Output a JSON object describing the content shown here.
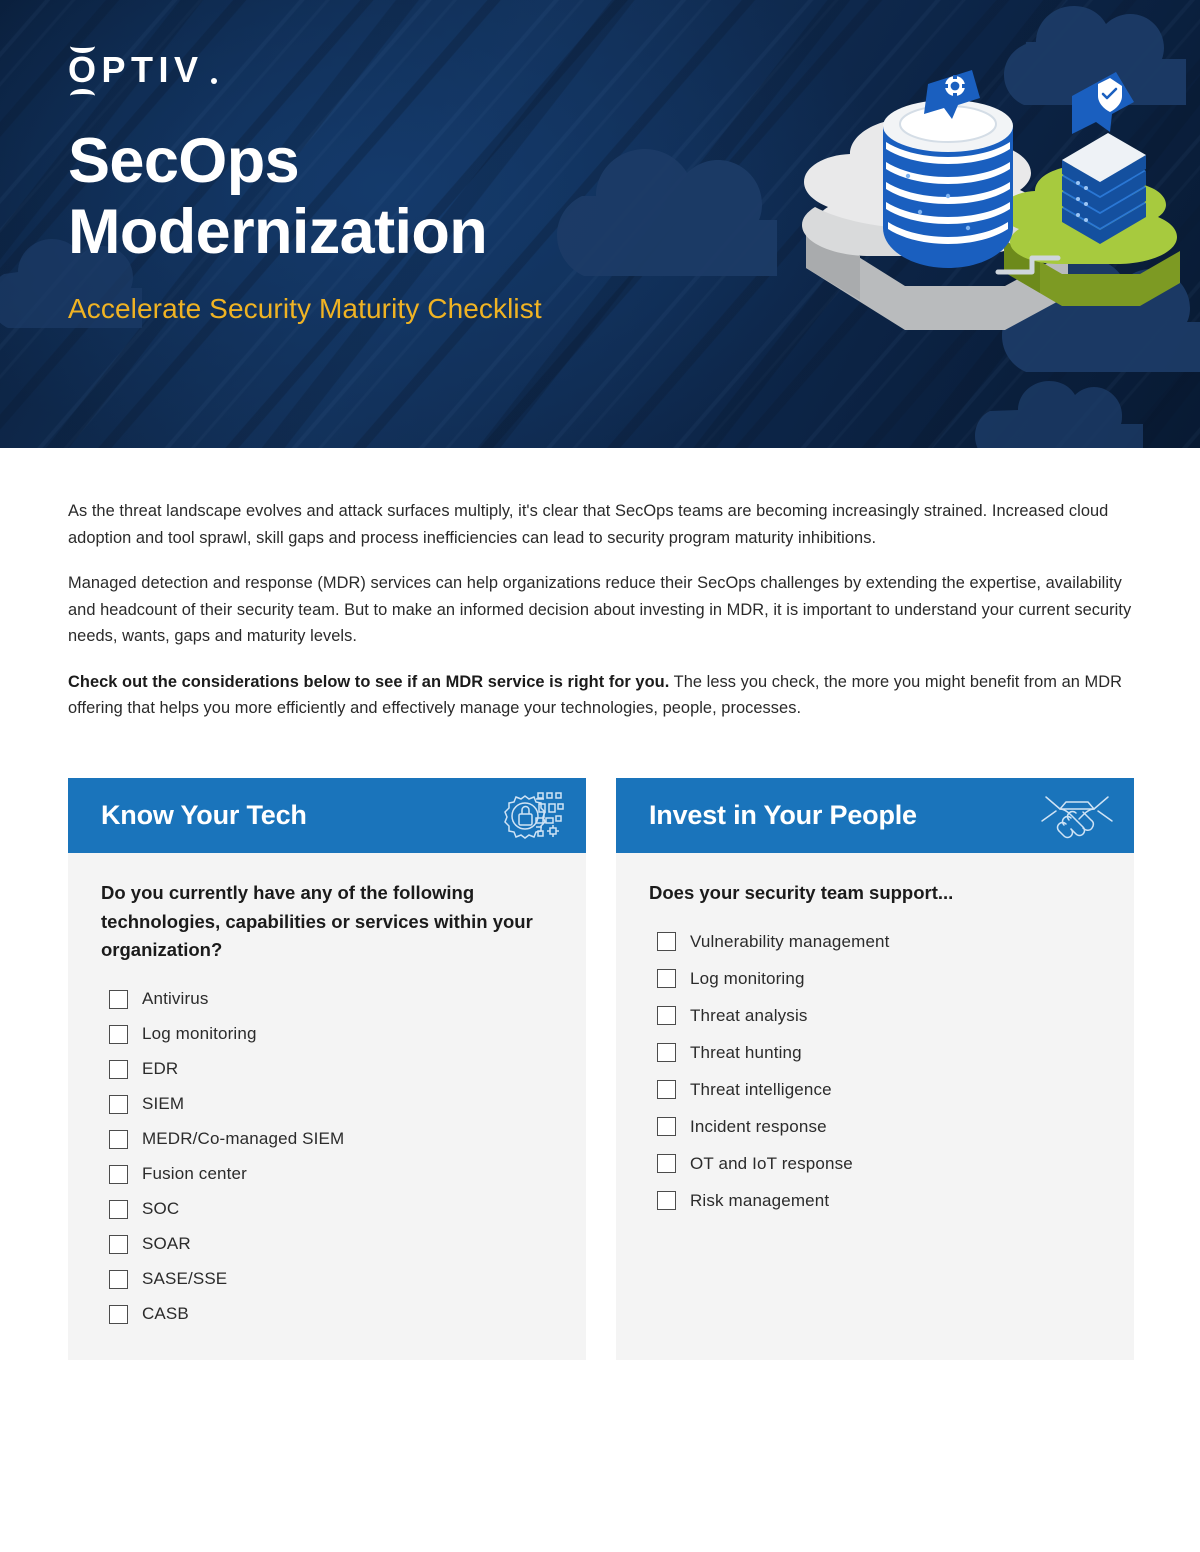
{
  "hero": {
    "logo": {
      "wordmark": "OPTIV",
      "icon_name": "optiv-logo"
    },
    "title_line1": "SecOps",
    "title_line2": "Modernization",
    "subtitle": "Accelerate Security Maturity Checklist",
    "illustration_name": "isometric-cloud-server-illustration",
    "colors": {
      "background_navy": "#0d2749",
      "subtitle_gold": "#f0b323",
      "cloud_white": "#e8e8e8",
      "cloud_green": "#a5c63b",
      "server_blue": "#1a5fbf",
      "decor_cloud": "#1c3a66"
    }
  },
  "intro": {
    "paragraph1": "As the threat landscape evolves and attack surfaces multiply, it's clear that SecOps teams are becoming increasingly strained. Increased cloud adoption and tool sprawl, skill gaps and process inefficiencies can lead to security program maturity inhibitions.",
    "paragraph2": "Managed detection and response (MDR) services can help organizations reduce their SecOps challenges by extending the expertise, availability and headcount of their security team. But to make an informed decision about investing in MDR, it is important to understand your current security needs, wants, gaps and maturity levels.",
    "paragraph3_bold": "Check out the considerations below to see if an MDR service is right for you.",
    "paragraph3_rest": " The less you check, the more you might benefit from an MDR offering that helps you more efficiently and effectively manage your technologies, people, processes."
  },
  "cards": [
    {
      "title": "Know Your Tech",
      "icon_name": "gear-lock-circuit-icon",
      "question": "Do you currently have any of the following technologies, capabilities or services within your organization?",
      "items": [
        "Antivirus",
        "Log monitoring",
        "EDR",
        "SIEM",
        "MEDR/Co-managed SIEM",
        "Fusion center",
        "SOC",
        "SOAR",
        "SASE/SSE",
        "CASB"
      ]
    },
    {
      "title": "Invest in Your People",
      "icon_name": "handshake-icon",
      "question": "Does your security team support...",
      "items": [
        "Vulnerability management",
        "Log monitoring",
        "Threat analysis",
        "Threat hunting",
        "Threat intelligence",
        "Incident response",
        "OT and IoT response",
        "Risk management"
      ]
    }
  ],
  "theme": {
    "header_blue": "#1a74bb",
    "card_bg": "#f4f4f4",
    "page_bg": "#ffffff",
    "text_dark": "#2a2a2a"
  }
}
